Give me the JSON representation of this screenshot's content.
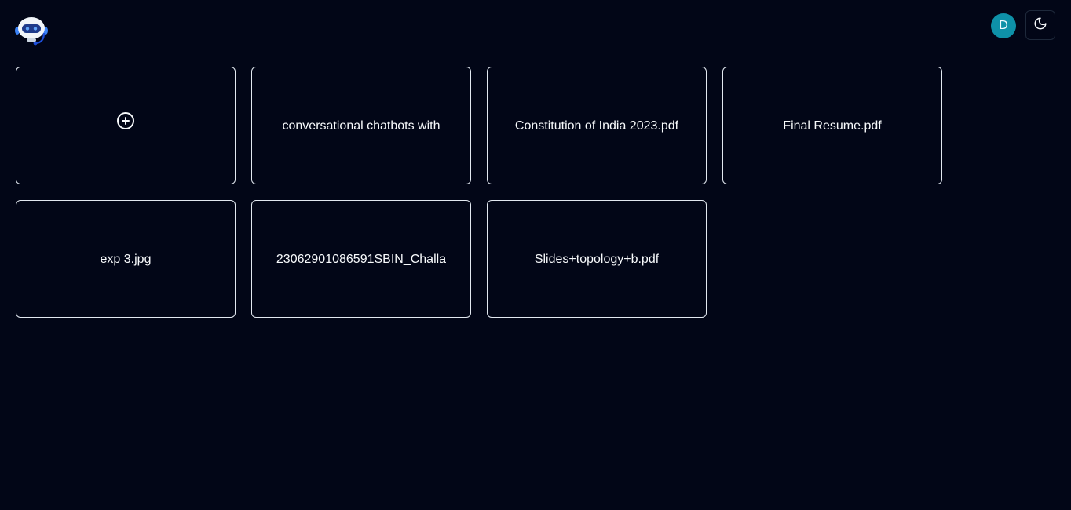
{
  "header": {
    "logo_icon": "robot-logo-icon",
    "avatar_initial": "D",
    "avatar_color": "#0e91a8",
    "theme_toggle_icon": "moon-icon"
  },
  "files": {
    "add_icon": "plus-circle-icon",
    "items": [
      {
        "name": "conversational chatbots with"
      },
      {
        "name": "Constitution of India 2023.pdf"
      },
      {
        "name": "Final Resume.pdf"
      },
      {
        "name": "exp 3.jpg"
      },
      {
        "name": "23062901086591SBIN_Challa"
      },
      {
        "name": "Slides+topology+b.pdf"
      }
    ]
  },
  "colors": {
    "background": "#020617",
    "card_border": "#e2e8f0",
    "text": "#f8fafc"
  }
}
